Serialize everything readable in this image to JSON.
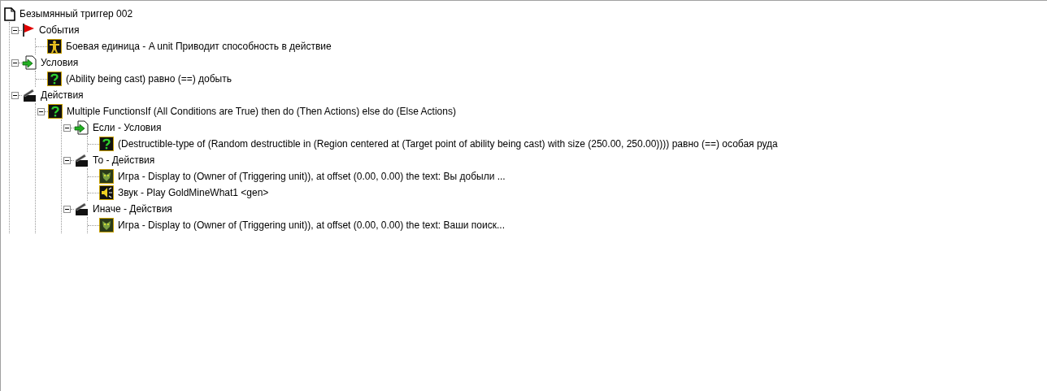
{
  "tree": {
    "label": "Безымянный триггер 002",
    "kind": "trigger",
    "children": [
      {
        "label": "События",
        "kind": "events",
        "expanded": true,
        "children": [
          {
            "label": "Боевая единица - A unit Приводит способность в действие",
            "kind": "unit"
          }
        ]
      },
      {
        "label": "Условия",
        "kind": "conditions",
        "expanded": true,
        "children": [
          {
            "label": "(Ability being cast) равно (==) добыть",
            "kind": "question"
          }
        ]
      },
      {
        "label": "Действия",
        "kind": "actions",
        "expanded": true,
        "children": [
          {
            "label": " Multiple FunctionsIf (All Conditions are True) then do (Then Actions) else do (Else Actions)",
            "kind": "question",
            "expanded": true,
            "children": [
              {
                "label": "Если - Условия",
                "kind": "conditions",
                "expanded": true,
                "children": [
                  {
                    "label": "(Destructible-type of (Random destructible in (Region centered at (Target point of ability being cast) with size (250.00, 250.00)))) равно (==) особая руда",
                    "kind": "question"
                  }
                ]
              },
              {
                "label": "То - Действия",
                "kind": "actions",
                "expanded": true,
                "children": [
                  {
                    "label": "Игра - Display to (Owner of (Triggering unit)), at offset (0.00, 0.00) the text: Вы добыли ...",
                    "kind": "game"
                  },
                  {
                    "label": "Звук - Play GoldMineWhat1 <gen>",
                    "kind": "sound"
                  }
                ]
              },
              {
                "label": "Иначе - Действия",
                "kind": "actions",
                "expanded": true,
                "children": [
                  {
                    "label": "Игра - Display to (Owner of (Triggering unit)), at offset (0.00, 0.00) the text: Ваши поиск...",
                    "kind": "game"
                  }
                ]
              }
            ]
          }
        ]
      }
    ]
  }
}
